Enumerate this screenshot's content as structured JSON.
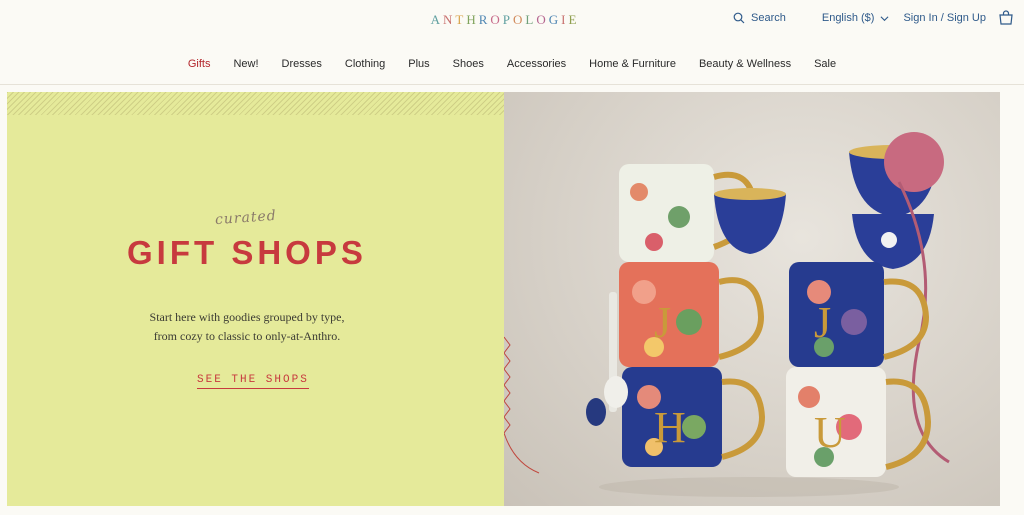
{
  "header": {
    "logo_letters": [
      "A",
      "N",
      "T",
      "H",
      "R",
      "O",
      "P",
      "O",
      "L",
      "O",
      "G",
      "I",
      "E"
    ],
    "logo_colors": [
      "#5f9fa0",
      "#c8706e",
      "#d9a44c",
      "#7fa35c",
      "#4f86b3",
      "#c76a8a",
      "#5f9fa0",
      "#d18a5b",
      "#6fa07a",
      "#b5658f",
      "#4f86b3",
      "#c8706e",
      "#8f9f4f"
    ],
    "search_label": "Search",
    "language_label": "English ($)",
    "signin_label": "Sign In / Sign Up"
  },
  "nav": {
    "items": [
      "Gifts",
      "New!",
      "Dresses",
      "Clothing",
      "Plus",
      "Shoes",
      "Accessories",
      "Home & Furniture",
      "Beauty & Wellness",
      "Sale"
    ]
  },
  "hero": {
    "kicker": "curated",
    "title": "GIFT SHOPS",
    "desc_line1": "Start here with goodies grouped by type,",
    "desc_line2": "from cozy to classic to only-at-Anthro.",
    "cta": "SEE THE SHOPS"
  },
  "colors": {
    "accent_red": "#b3262c",
    "link_blue": "#2f5a8a",
    "panel_yellow": "#e5ea9a"
  },
  "icons": [
    "search-icon",
    "chevron-down-icon",
    "shopping-bag-icon"
  ]
}
